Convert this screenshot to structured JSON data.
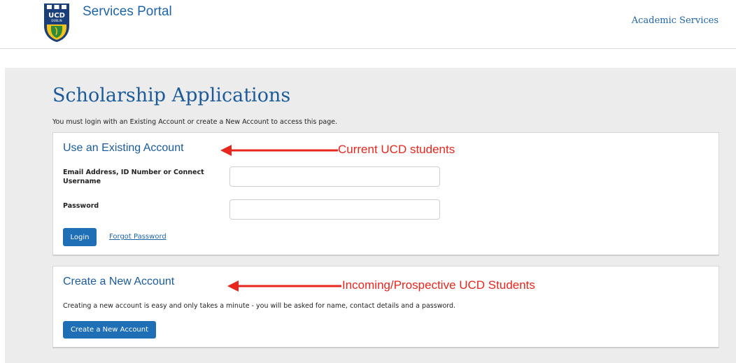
{
  "header": {
    "logo_text": "UCD DUBLIN",
    "portal_title": "Services Portal",
    "academic_link": "Academic Services"
  },
  "main": {
    "title": "Scholarship Applications",
    "intro": "You must login with an Existing Account or create a New Account to access this page."
  },
  "existing_account": {
    "title": "Use an Existing Account",
    "username_label": "Email Address, ID Number or Connect Username",
    "username_value": "",
    "password_label": "Password",
    "password_value": "",
    "login_button": "Login",
    "forgot_link": "Forgot Password"
  },
  "new_account": {
    "title": "Create a New Account",
    "description": "Creating a new account is easy and only takes a minute - you will be asked for name, contact details and a password.",
    "create_button": "Create a New Account"
  },
  "annotations": {
    "current": "Current UCD students",
    "incoming": "Incoming/Prospective UCD Students"
  },
  "colors": {
    "brand_blue": "#1f6fb6",
    "heading_blue": "#1b5b9a",
    "annotation_red": "#e8261e"
  }
}
